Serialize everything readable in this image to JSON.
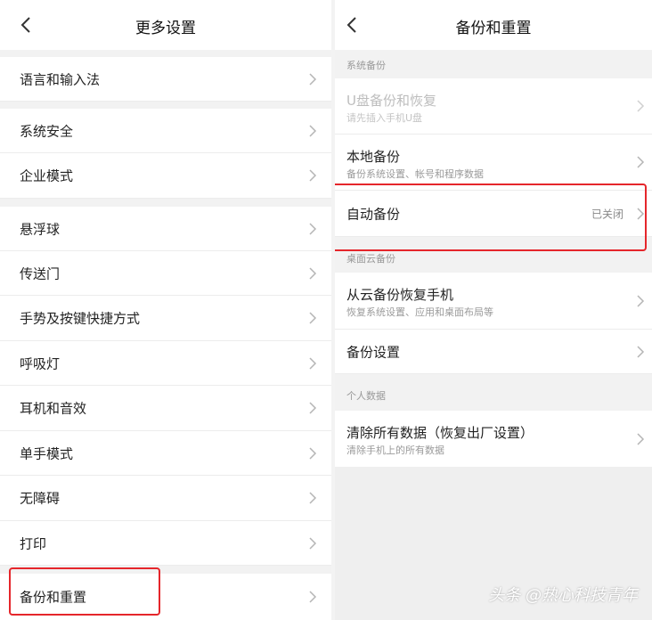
{
  "left": {
    "title": "更多设置",
    "items": [
      {
        "label": "语言和输入法"
      },
      {
        "label": "系统安全"
      },
      {
        "label": "企业模式"
      },
      {
        "label": "悬浮球"
      },
      {
        "label": "传送门"
      },
      {
        "label": "手势及按键快捷方式"
      },
      {
        "label": "呼吸灯"
      },
      {
        "label": "耳机和音效"
      },
      {
        "label": "单手模式"
      },
      {
        "label": "无障碍"
      },
      {
        "label": "打印"
      },
      {
        "label": "备份和重置"
      }
    ]
  },
  "right": {
    "title": "备份和重置",
    "sections": {
      "system_backup": "系统备份",
      "cloud_backup": "桌面云备份",
      "personal_data": "个人数据"
    },
    "items": {
      "usb": {
        "main": "U盘备份和恢复",
        "sub": "请先插入手机U盘"
      },
      "local": {
        "main": "本地备份",
        "sub": "备份系统设置、帐号和程序数据"
      },
      "auto": {
        "main": "自动备份",
        "status": "已关闭"
      },
      "restore_cloud": {
        "main": "从云备份恢复手机",
        "sub": "恢复系统设置、应用和桌面布局等"
      },
      "backup_settings": {
        "main": "备份设置"
      },
      "clear_all": {
        "main": "清除所有数据（恢复出厂设置）",
        "sub": "清除手机上的所有数据"
      }
    }
  },
  "watermark": "头条 @热心科技青年",
  "colors": {
    "highlight": "#e5262b",
    "section_bg": "#f2f2f2"
  },
  "icons": {
    "back": "chevron-left-icon",
    "row": "chevron-right-icon"
  }
}
